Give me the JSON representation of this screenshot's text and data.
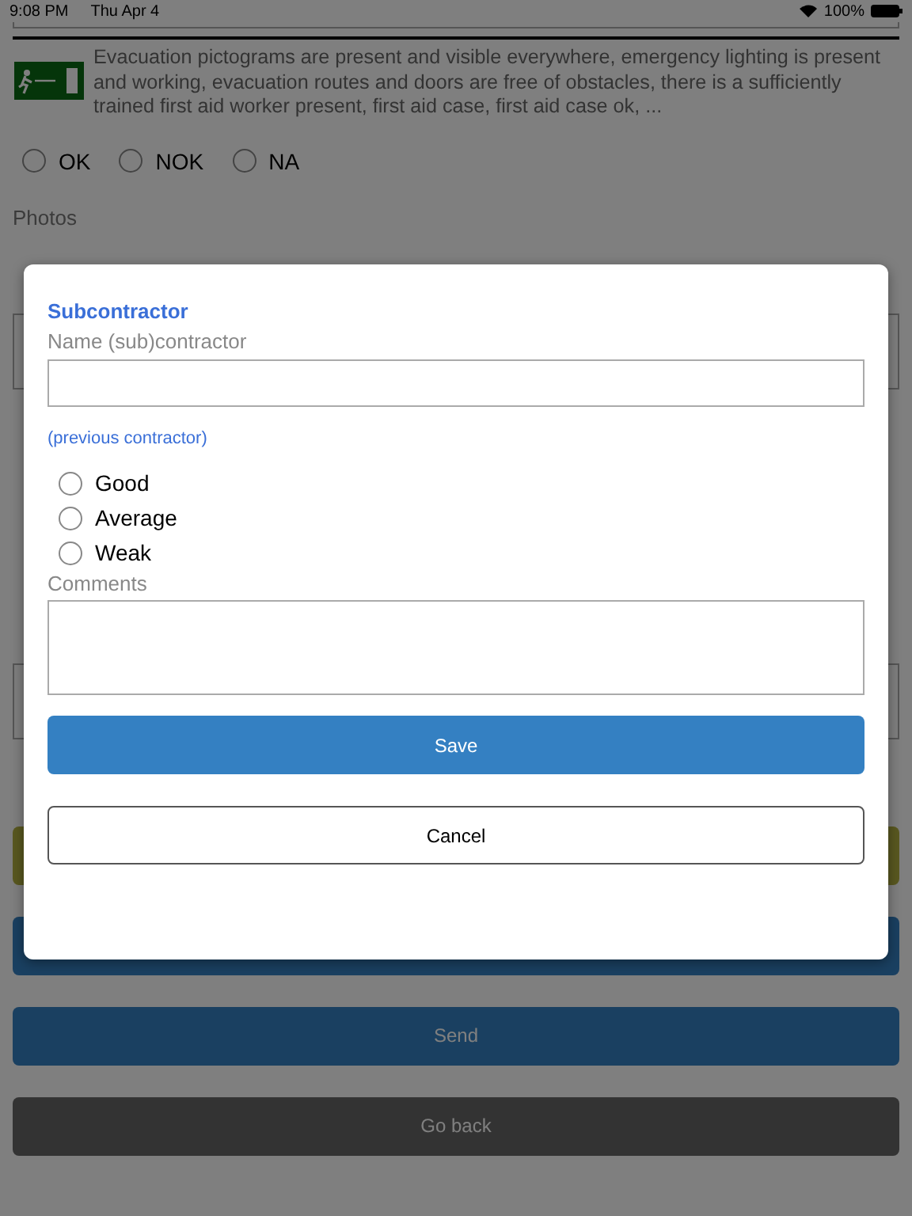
{
  "status_bar": {
    "time": "9:08 PM",
    "date": "Thu Apr 4",
    "battery": "100%"
  },
  "checklist_item": {
    "text": "Evacuation pictograms are present and visible everywhere, emergency lighting is present and working, evacuation routes and doors are free of obstacles, there is a sufficiently trained first aid worker present, first aid case, first aid case ok, ...",
    "options": [
      {
        "label": "OK",
        "selected": false
      },
      {
        "label": "NOK",
        "selected": false
      },
      {
        "label": "NA",
        "selected": false
      }
    ]
  },
  "photos_label": "Photos",
  "page_buttons": [
    {
      "kind": "olive"
    },
    {
      "kind": "primary"
    },
    {
      "kind": "primary",
      "label": "Send"
    },
    {
      "kind": "dark",
      "label": "Go back"
    }
  ],
  "dialog": {
    "title": "Subcontractor",
    "name_label": "Name (sub)contractor",
    "previous_link": "(previous contractor)",
    "ratings": [
      {
        "label": "Good",
        "selected": false
      },
      {
        "label": "Average",
        "selected": false
      },
      {
        "label": "Weak",
        "selected": false
      }
    ],
    "comments_label": "Comments",
    "buttons": [
      {
        "kind": "primary",
        "label": "Save"
      },
      {
        "kind": "outline",
        "label": "Cancel"
      }
    ]
  }
}
